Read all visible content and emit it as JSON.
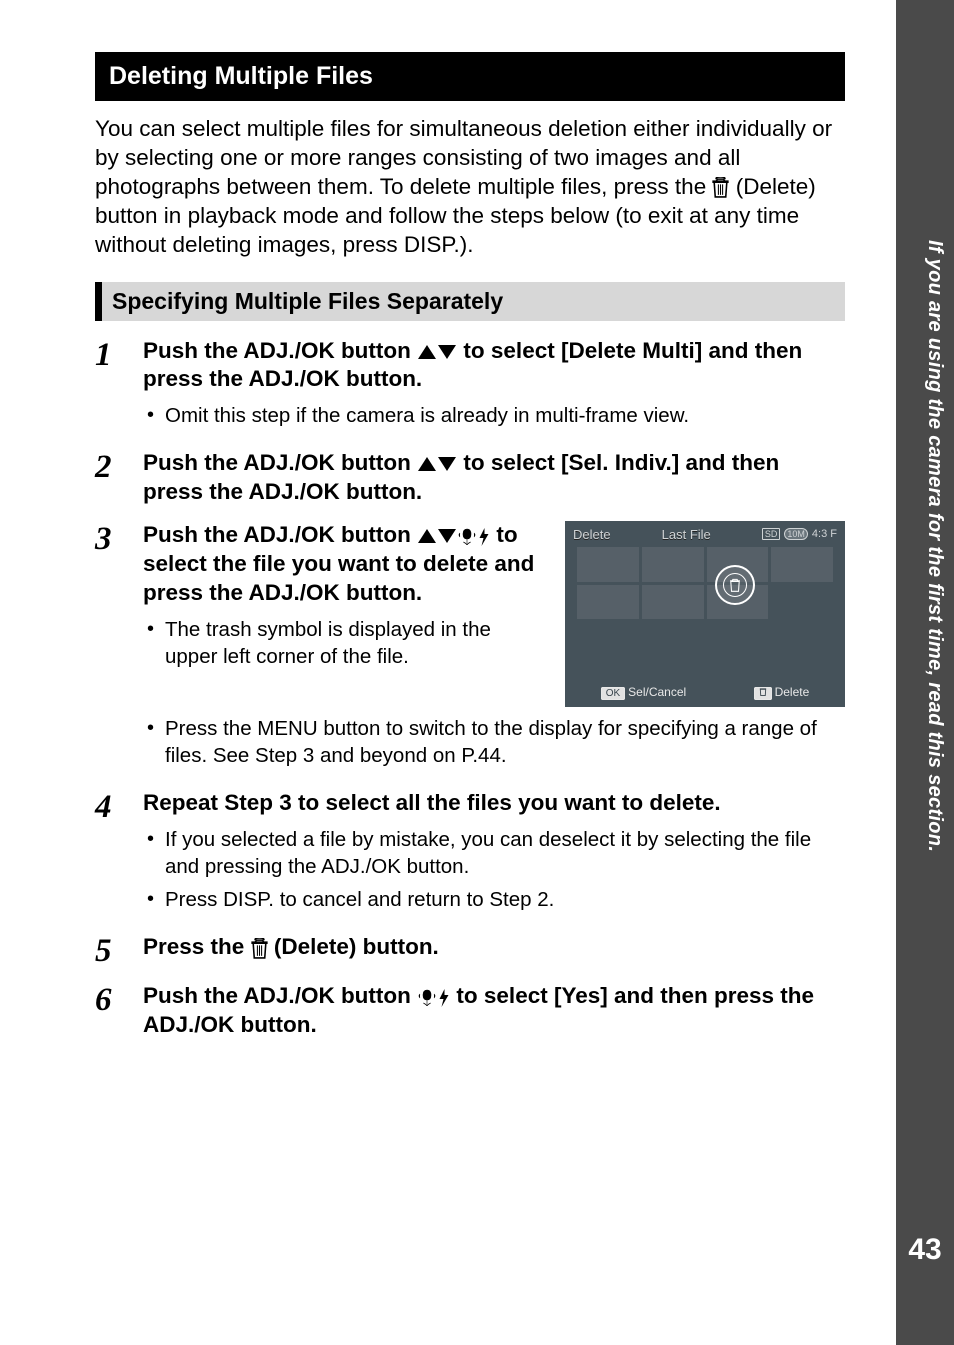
{
  "sidebar": {
    "text": "If you are using the camera for the first time, read this section.",
    "page_number": "43"
  },
  "heading": "Deleting Multiple Files",
  "intro": {
    "pre": "You can select multiple files for simultaneous deletion either individually or by selecting one or more ranges consisting of two images and all photographs between them. To delete multiple files, press the ",
    "mid": " (Delete) button in playback mode and follow the steps below (to exit at any time without deleting images, press DISP.)."
  },
  "subheading": "Specifying Multiple Files Separately",
  "steps": {
    "s1": {
      "num": "1",
      "heading_pre": "Push the ADJ./OK button ",
      "heading_post": " to select [Delete Multi] and then press the ADJ./OK button.",
      "bullet1": "Omit this step if the camera is already in multi-frame view."
    },
    "s2": {
      "num": "2",
      "heading_pre": "Push the ADJ./OK button ",
      "heading_post": " to select [Sel. Indiv.] and then press the ADJ./OK button."
    },
    "s3": {
      "num": "3",
      "heading_pre": "Push the ADJ./OK button ",
      "heading_post": " to select the file you want to delete and press the ADJ./OK button.",
      "bullet1": "The trash symbol is displayed in the upper left corner of the file.",
      "bullet2": "Press the MENU button to switch to the display for specifying a range of files. See Step 3 and beyond on P.44."
    },
    "s4": {
      "num": "4",
      "heading": "Repeat Step 3 to select all the files you want to delete.",
      "bullet1": "If you selected a file by mistake, you can deselect it by selecting the file and pressing the ADJ./OK button.",
      "bullet2": "Press DISP. to cancel and return to Step 2."
    },
    "s5": {
      "num": "5",
      "heading_pre": "Press the ",
      "heading_post": " (Delete) button."
    },
    "s6": {
      "num": "6",
      "heading_pre": "Push the ADJ./OK button ",
      "heading_post": " to select [Yes] and then press the ADJ./OK button."
    }
  },
  "figure": {
    "delete": "Delete",
    "last_file": "Last File",
    "sd": "SD",
    "res": "10M",
    "ratio": "4:3 F",
    "sel_cancel_key": "OK",
    "sel_cancel": "Sel/Cancel",
    "del_key_icon": "trash",
    "del_label": "Delete"
  },
  "icons": {
    "trash": "trash-icon",
    "up": "triangle-up-icon",
    "down": "triangle-down-icon",
    "macro": "macro-icon",
    "flash": "flash-icon"
  }
}
